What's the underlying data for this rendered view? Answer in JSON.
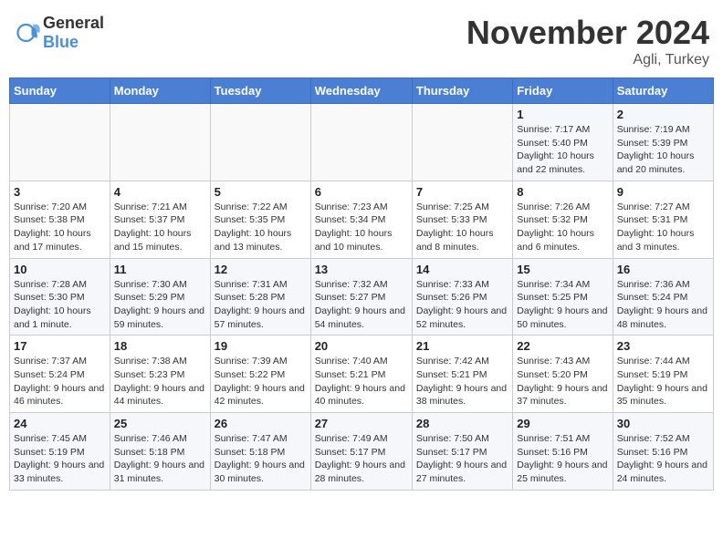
{
  "header": {
    "logo_general": "General",
    "logo_blue": "Blue",
    "month": "November 2024",
    "location": "Agli, Turkey"
  },
  "weekdays": [
    "Sunday",
    "Monday",
    "Tuesday",
    "Wednesday",
    "Thursday",
    "Friday",
    "Saturday"
  ],
  "weeks": [
    [
      {
        "day": "",
        "info": ""
      },
      {
        "day": "",
        "info": ""
      },
      {
        "day": "",
        "info": ""
      },
      {
        "day": "",
        "info": ""
      },
      {
        "day": "",
        "info": ""
      },
      {
        "day": "1",
        "info": "Sunrise: 7:17 AM\nSunset: 5:40 PM\nDaylight: 10 hours and 22 minutes."
      },
      {
        "day": "2",
        "info": "Sunrise: 7:19 AM\nSunset: 5:39 PM\nDaylight: 10 hours and 20 minutes."
      }
    ],
    [
      {
        "day": "3",
        "info": "Sunrise: 7:20 AM\nSunset: 5:38 PM\nDaylight: 10 hours and 17 minutes."
      },
      {
        "day": "4",
        "info": "Sunrise: 7:21 AM\nSunset: 5:37 PM\nDaylight: 10 hours and 15 minutes."
      },
      {
        "day": "5",
        "info": "Sunrise: 7:22 AM\nSunset: 5:35 PM\nDaylight: 10 hours and 13 minutes."
      },
      {
        "day": "6",
        "info": "Sunrise: 7:23 AM\nSunset: 5:34 PM\nDaylight: 10 hours and 10 minutes."
      },
      {
        "day": "7",
        "info": "Sunrise: 7:25 AM\nSunset: 5:33 PM\nDaylight: 10 hours and 8 minutes."
      },
      {
        "day": "8",
        "info": "Sunrise: 7:26 AM\nSunset: 5:32 PM\nDaylight: 10 hours and 6 minutes."
      },
      {
        "day": "9",
        "info": "Sunrise: 7:27 AM\nSunset: 5:31 PM\nDaylight: 10 hours and 3 minutes."
      }
    ],
    [
      {
        "day": "10",
        "info": "Sunrise: 7:28 AM\nSunset: 5:30 PM\nDaylight: 10 hours and 1 minute."
      },
      {
        "day": "11",
        "info": "Sunrise: 7:30 AM\nSunset: 5:29 PM\nDaylight: 9 hours and 59 minutes."
      },
      {
        "day": "12",
        "info": "Sunrise: 7:31 AM\nSunset: 5:28 PM\nDaylight: 9 hours and 57 minutes."
      },
      {
        "day": "13",
        "info": "Sunrise: 7:32 AM\nSunset: 5:27 PM\nDaylight: 9 hours and 54 minutes."
      },
      {
        "day": "14",
        "info": "Sunrise: 7:33 AM\nSunset: 5:26 PM\nDaylight: 9 hours and 52 minutes."
      },
      {
        "day": "15",
        "info": "Sunrise: 7:34 AM\nSunset: 5:25 PM\nDaylight: 9 hours and 50 minutes."
      },
      {
        "day": "16",
        "info": "Sunrise: 7:36 AM\nSunset: 5:24 PM\nDaylight: 9 hours and 48 minutes."
      }
    ],
    [
      {
        "day": "17",
        "info": "Sunrise: 7:37 AM\nSunset: 5:24 PM\nDaylight: 9 hours and 46 minutes."
      },
      {
        "day": "18",
        "info": "Sunrise: 7:38 AM\nSunset: 5:23 PM\nDaylight: 9 hours and 44 minutes."
      },
      {
        "day": "19",
        "info": "Sunrise: 7:39 AM\nSunset: 5:22 PM\nDaylight: 9 hours and 42 minutes."
      },
      {
        "day": "20",
        "info": "Sunrise: 7:40 AM\nSunset: 5:21 PM\nDaylight: 9 hours and 40 minutes."
      },
      {
        "day": "21",
        "info": "Sunrise: 7:42 AM\nSunset: 5:21 PM\nDaylight: 9 hours and 38 minutes."
      },
      {
        "day": "22",
        "info": "Sunrise: 7:43 AM\nSunset: 5:20 PM\nDaylight: 9 hours and 37 minutes."
      },
      {
        "day": "23",
        "info": "Sunrise: 7:44 AM\nSunset: 5:19 PM\nDaylight: 9 hours and 35 minutes."
      }
    ],
    [
      {
        "day": "24",
        "info": "Sunrise: 7:45 AM\nSunset: 5:19 PM\nDaylight: 9 hours and 33 minutes."
      },
      {
        "day": "25",
        "info": "Sunrise: 7:46 AM\nSunset: 5:18 PM\nDaylight: 9 hours and 31 minutes."
      },
      {
        "day": "26",
        "info": "Sunrise: 7:47 AM\nSunset: 5:18 PM\nDaylight: 9 hours and 30 minutes."
      },
      {
        "day": "27",
        "info": "Sunrise: 7:49 AM\nSunset: 5:17 PM\nDaylight: 9 hours and 28 minutes."
      },
      {
        "day": "28",
        "info": "Sunrise: 7:50 AM\nSunset: 5:17 PM\nDaylight: 9 hours and 27 minutes."
      },
      {
        "day": "29",
        "info": "Sunrise: 7:51 AM\nSunset: 5:16 PM\nDaylight: 9 hours and 25 minutes."
      },
      {
        "day": "30",
        "info": "Sunrise: 7:52 AM\nSunset: 5:16 PM\nDaylight: 9 hours and 24 minutes."
      }
    ]
  ]
}
